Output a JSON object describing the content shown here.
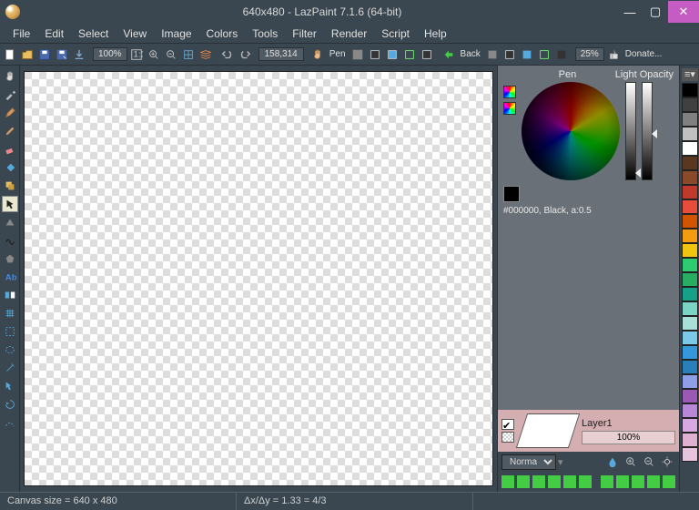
{
  "titlebar": {
    "title": "640x480 - LazPaint 7.1.6 (64-bit)"
  },
  "menu": [
    "File",
    "Edit",
    "Select",
    "View",
    "Image",
    "Colors",
    "Tools",
    "Filter",
    "Render",
    "Script",
    "Help"
  ],
  "toolbar": {
    "zoom": "100%",
    "coords": "158,314",
    "pen_label": "Pen",
    "back_label": "Back",
    "opacity_pct": "25%",
    "donate": "Donate..."
  },
  "color_panel": {
    "pen_label": "Pen",
    "light_label": "Light Opacity",
    "color_info": "#000000, Black, a:0.5"
  },
  "layer": {
    "name": "Layer1",
    "opacity": "100%",
    "blend": "Normal"
  },
  "status": {
    "canvas": "Canvas size = 640 x 480",
    "ratio": "Δx/Δy = 1.33 = 4/3"
  },
  "swatches": [
    "#000000",
    "#404040",
    "#808080",
    "#c0c0c0",
    "#ffffff",
    "#5a3820",
    "#8a4a2a",
    "#c0392b",
    "#e74c3c",
    "#d35400",
    "#f39c12",
    "#f1c40f",
    "#2ecc71",
    "#27ae60",
    "#16a085",
    "#7bd4c4",
    "#a8e0d8",
    "#7cc8e8",
    "#3498db",
    "#2980b9",
    "#8e9ee8",
    "#9b59b6",
    "#b888d8",
    "#d8a8e0",
    "#e0b0d0",
    "#e8c4dc"
  ]
}
